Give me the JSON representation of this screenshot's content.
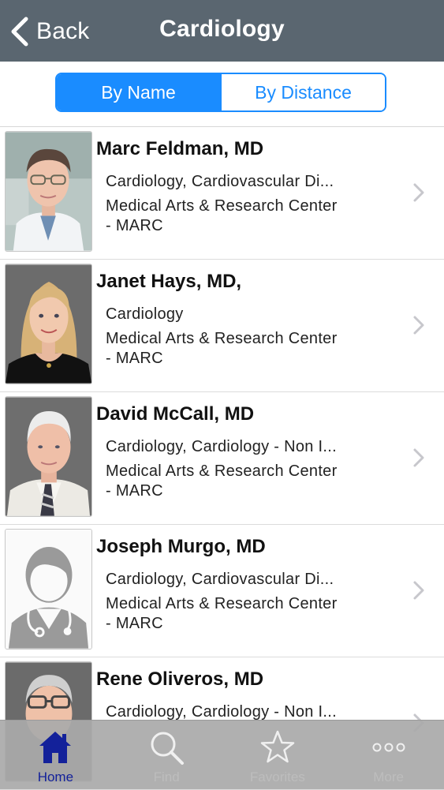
{
  "nav": {
    "back_label": "Back",
    "title": "Cardiology"
  },
  "segments": {
    "by_name": "By Name",
    "by_distance": "By Distance",
    "selected": "By Name"
  },
  "doctors": [
    {
      "name": "Marc Feldman, MD",
      "specialty": "Cardiology, Cardiovascular Di...",
      "location_line1": "Medical Arts & Research Center",
      "location_line2": "- MARC"
    },
    {
      "name": "Janet Hays, MD,",
      "specialty": "Cardiology",
      "location_line1": "Medical Arts & Research Center",
      "location_line2": "- MARC"
    },
    {
      "name": "David McCall, MD",
      "specialty": "Cardiology, Cardiology - Non I...",
      "location_line1": "Medical Arts & Research Center",
      "location_line2": "- MARC"
    },
    {
      "name": "Joseph Murgo, MD",
      "specialty": "Cardiology, Cardiovascular Di...",
      "location_line1": "Medical Arts & Research Center",
      "location_line2": "- MARC"
    },
    {
      "name": "Rene Oliveros, MD",
      "specialty": "Cardiology, Cardiology - Non I...",
      "location_line1": "",
      "location_line2": ""
    }
  ],
  "tabbar": {
    "home": "Home",
    "find": "Find",
    "favorites": "Favorites",
    "more": "More",
    "active": "Home"
  },
  "colors": {
    "navbar": "#5a6670",
    "accent": "#1a8cff",
    "tab_active": "#13219a"
  },
  "icons": {
    "back": "chevron-left-icon",
    "row_chevron": "chevron-right-icon",
    "home": "home-icon",
    "find": "search-icon",
    "favorites": "star-icon",
    "more": "more-dots-icon",
    "placeholder_photo": "doctor-placeholder-icon"
  }
}
